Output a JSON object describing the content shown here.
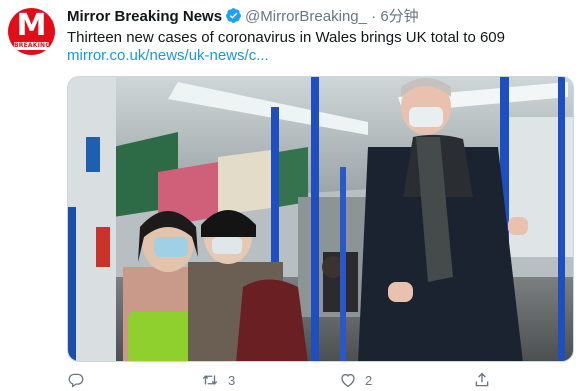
{
  "tweet": {
    "author_name": "Mirror Breaking News",
    "author_handle": "@MirrorBreaking_",
    "separator": "·",
    "time": "6分钟",
    "text": "Thirteen new cases of coronavirus in Wales brings UK total to 609",
    "link": "mirror.co.uk/news/uk-news/c...",
    "avatar": {
      "letter": "M",
      "banner": "BREAKING"
    },
    "accent_color": "#1b95e0"
  },
  "actions": {
    "reply": {
      "icon": "reply-icon",
      "count": ""
    },
    "retweet": {
      "icon": "retweet-icon",
      "count": "3"
    },
    "like": {
      "icon": "heart-icon",
      "count": "2"
    },
    "share": {
      "icon": "share-icon",
      "count": ""
    }
  }
}
